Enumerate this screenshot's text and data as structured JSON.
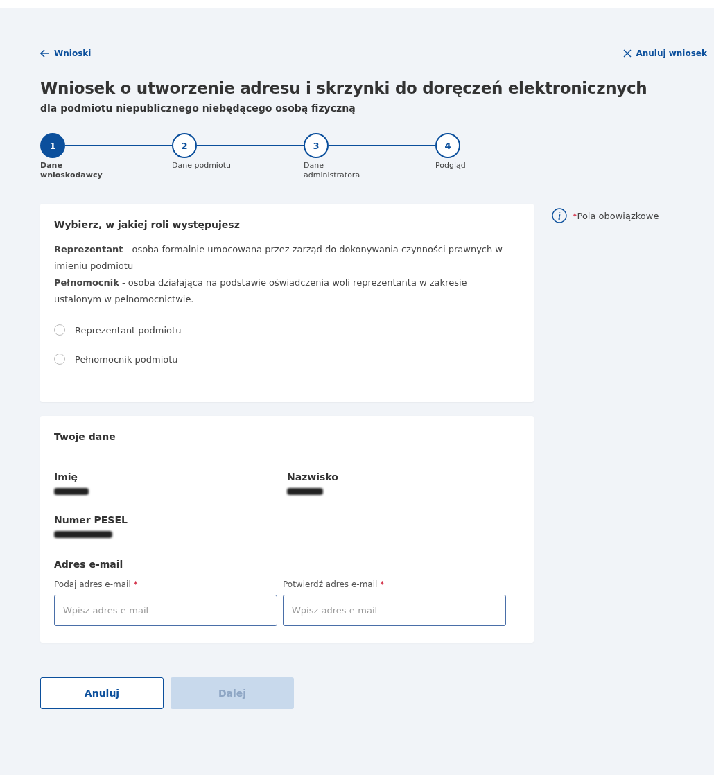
{
  "back_link": {
    "label": "Wnioski"
  },
  "cancel_link": {
    "label": "Anuluj wniosek"
  },
  "title": "Wniosek o utworzenie adresu i skrzynki do doręczeń elektronicznych",
  "subtitle": "dla podmiotu niepublicznego niebędącego osobą fizyczną",
  "steps": [
    {
      "number": "1",
      "label": "Dane wnioskodawcy",
      "selected": true
    },
    {
      "number": "2",
      "label": "Dane podmiotu",
      "selected": false
    },
    {
      "number": "3",
      "label": "Dane administratora",
      "selected": false
    },
    {
      "number": "4",
      "label": "Podgląd",
      "selected": false
    }
  ],
  "required_note": {
    "mark": "*",
    "text": "Pola obowiązkowe"
  },
  "role_card": {
    "heading": "Wybierz, w jakiej roli występujesz",
    "descriptions": [
      "**Reprezentant** - osoba formalnie umocowana przez zarząd do dokonywania czynności prawnych w imieniu podmiotu",
      "**Pełnomocnik** - osoba działająca na podstawie oświadczenia woli reprezentanta w zakresie ustalonym w pełnomocnictwie."
    ],
    "options": [
      {
        "label": "Reprezentant podmiotu",
        "selected": false
      },
      {
        "label": "Pełnomocnik podmiotu",
        "selected": false
      }
    ]
  },
  "data_card": {
    "heading": "Twoje dane",
    "fields": [
      {
        "label": "Imię",
        "redacted": true
      },
      {
        "label": "Nazwisko",
        "redacted": true
      },
      {
        "label": "Numer PESEL",
        "redacted": true
      }
    ],
    "email_heading": "Adres e-mail",
    "email_inputs": [
      {
        "label": "Podaj adres e-mail",
        "required": true,
        "placeholder": "Wpisz adres e-mail"
      },
      {
        "label": "Potwierdź adres e-mail",
        "required": true,
        "placeholder": "Wpisz adres e-mail"
      }
    ]
  },
  "buttons": [
    {
      "label": "Anuluj",
      "kind": "secondary",
      "disabled": false
    },
    {
      "label": "Dalej",
      "kind": "primary",
      "disabled": true
    }
  ]
}
